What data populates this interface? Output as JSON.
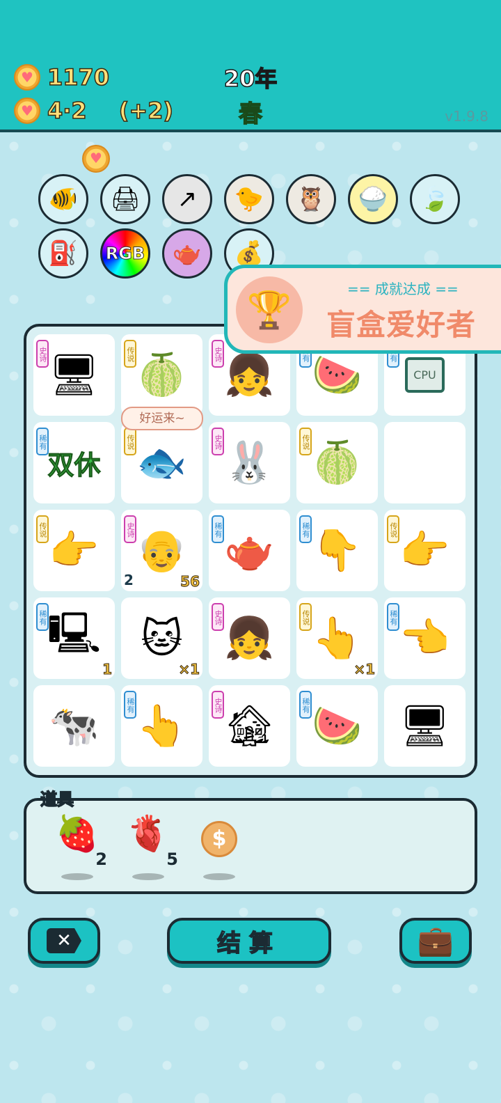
{
  "header": {
    "coins": "1170",
    "income": "4·2",
    "bonus": "(+2)",
    "year": "20年",
    "season": "春",
    "version": "v1.9.8"
  },
  "relics": [
    {
      "name": "fishbowl-icon"
    },
    {
      "name": "printer-icon"
    },
    {
      "name": "arrow-card-icon"
    },
    {
      "name": "chick-egg-icon"
    },
    {
      "name": "owls-icon"
    },
    {
      "name": "rice-bowl-icon"
    },
    {
      "name": "leaf-icon"
    },
    {
      "name": "pump-icon"
    },
    {
      "name": "rgb-icon",
      "text": "RGB"
    },
    {
      "name": "gravy-boat-icon"
    },
    {
      "name": "sack-icon"
    }
  ],
  "achievement": {
    "subtitle": "== 成就达成 ==",
    "title": "盲盒爱好者"
  },
  "bubble": "好运来~",
  "tags": {
    "epic": "史诗",
    "legend": "传说",
    "rare": "稀有"
  },
  "board": [
    {
      "icon": "gpu-icon",
      "glyph": "🖥",
      "tag": "epic"
    },
    {
      "icon": "watermelon-ball-icon",
      "glyph": "🍈",
      "tag": "legend"
    },
    {
      "icon": "girl-braids-icon",
      "glyph": "👧",
      "tag": "epic"
    },
    {
      "icon": "watermelon-slice-icon",
      "glyph": "🍉",
      "tag": "rare"
    },
    {
      "icon": "cpu-icon",
      "glyph": "CPU",
      "tag": "rare"
    },
    {
      "icon": "double-rest-icon",
      "glyph": "双休",
      "tag": "rare"
    },
    {
      "icon": "koi-fish-icon",
      "glyph": "🐟",
      "tag": "legend"
    },
    {
      "icon": "rabbit-shrine-icon",
      "glyph": "🐰",
      "tag": "epic"
    },
    {
      "icon": "big-watermelon-icon",
      "glyph": "🍈",
      "tag": "legend"
    },
    {
      "icon": "empty-cell",
      "glyph": "",
      "tag": ""
    },
    {
      "icon": "yellow-point-icon",
      "glyph": "👉",
      "tag": "legend"
    },
    {
      "icon": "grandpa-heart-icon",
      "glyph": "👴",
      "tag": "epic",
      "left": "2",
      "right": "56"
    },
    {
      "icon": "teapot-icon",
      "glyph": "🫖",
      "tag": "rare"
    },
    {
      "icon": "brown-point-down-icon",
      "glyph": "👇",
      "tag": "rare"
    },
    {
      "icon": "yellow-point-right-icon",
      "glyph": "👉",
      "tag": "legend"
    },
    {
      "icon": "pc-tower-icon",
      "glyph": "🖳",
      "tag": "rare",
      "right": "1"
    },
    {
      "icon": "cat-icon",
      "glyph": "🐱",
      "tag": "",
      "right": "×1"
    },
    {
      "icon": "girl-braids-icon",
      "glyph": "👧",
      "tag": "epic"
    },
    {
      "icon": "yellow-point-up-icon",
      "glyph": "👆",
      "tag": "legend",
      "right": "×1"
    },
    {
      "icon": "brown-point-left-icon",
      "glyph": "👈",
      "tag": "rare"
    },
    {
      "icon": "cow-icon",
      "glyph": "🐄",
      "tag": ""
    },
    {
      "icon": "brown-point-up-icon",
      "glyph": "👆",
      "tag": "rare"
    },
    {
      "icon": "haunted-house-icon",
      "glyph": "🏚",
      "tag": "epic"
    },
    {
      "icon": "watermelon-slice-icon",
      "glyph": "🍉",
      "tag": "rare"
    },
    {
      "icon": "monitor-icon",
      "glyph": "🖥",
      "tag": ""
    }
  ],
  "items": {
    "label": "道具",
    "list": [
      {
        "icon": "lychee-icon",
        "glyph": "🍓",
        "count": "2"
      },
      {
        "icon": "liver-icon",
        "glyph": "🫀",
        "count": "5"
      },
      {
        "icon": "dollar-coin-icon",
        "glyph": "$",
        "count": ""
      }
    ]
  },
  "buttons": {
    "settle": "结算"
  }
}
